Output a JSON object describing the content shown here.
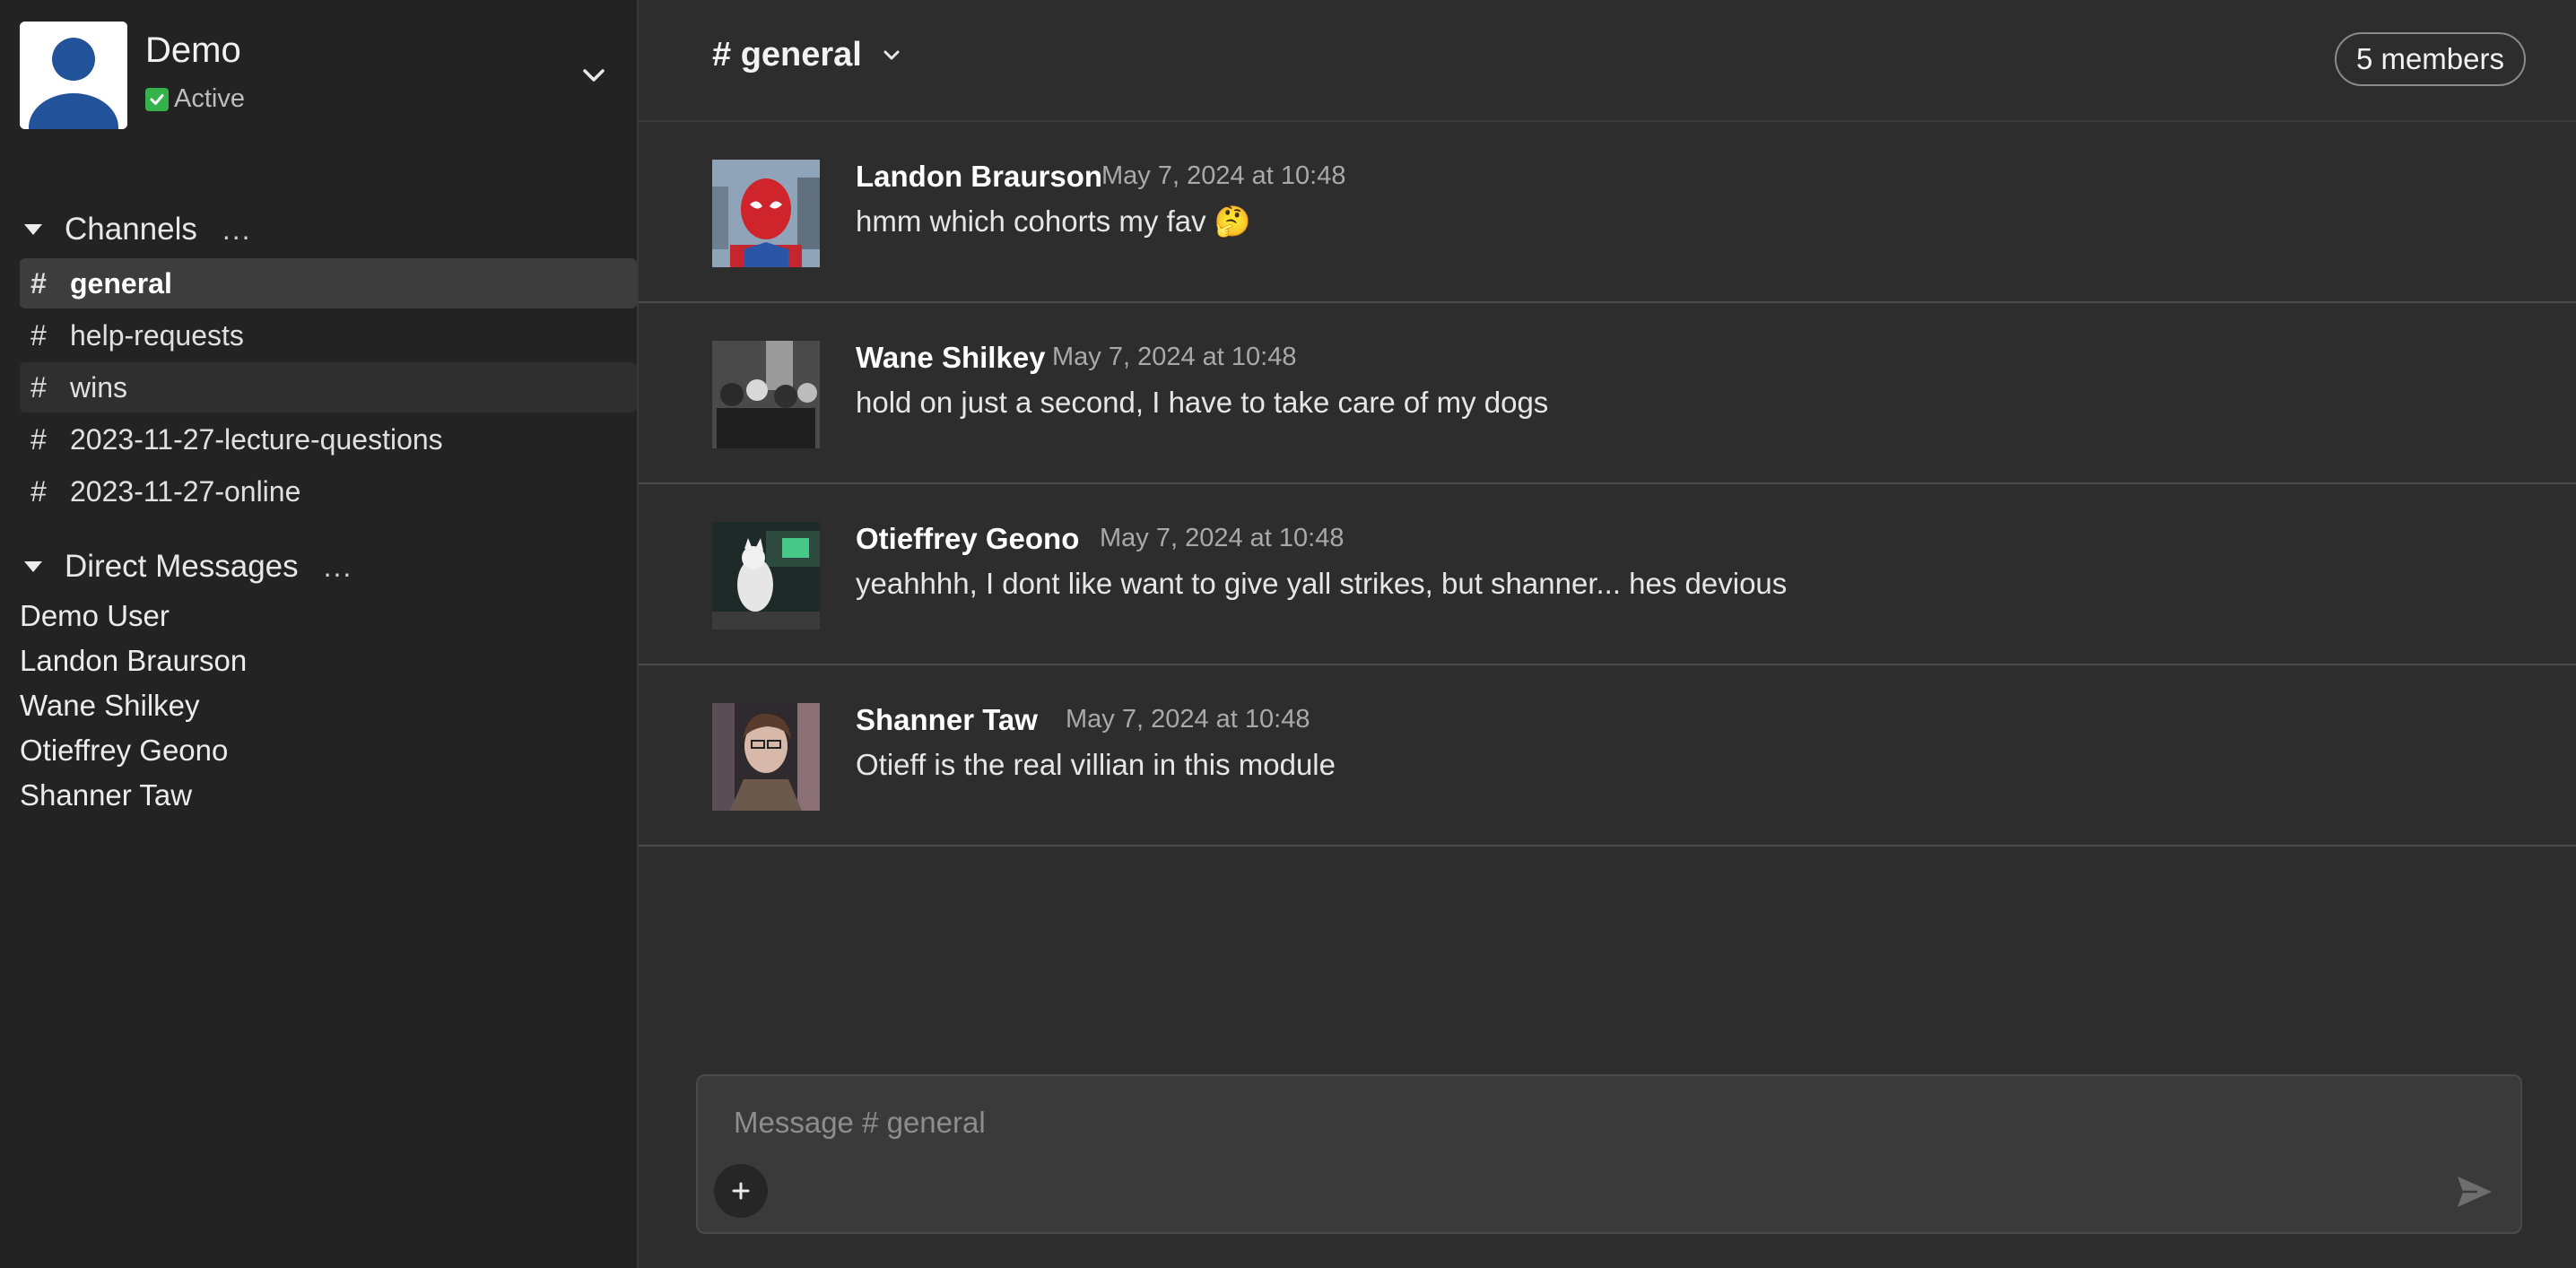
{
  "user": {
    "name": "Demo",
    "status": "Active",
    "status_icon": "check-mark-icon",
    "status_color": "#33b34a"
  },
  "channels_section": {
    "label": "Channels",
    "more": "...",
    "items": [
      {
        "hash": "#",
        "label": "general",
        "state": "active"
      },
      {
        "hash": "#",
        "label": "help-requests",
        "state": "normal"
      },
      {
        "hash": "#",
        "label": "wins",
        "state": "hover"
      },
      {
        "hash": "#",
        "label": "2023-11-27-lecture-questions",
        "state": "normal"
      },
      {
        "hash": "#",
        "label": "2023-11-27-online",
        "state": "normal"
      }
    ]
  },
  "dm_section": {
    "label": "Direct Messages",
    "more": "...",
    "items": [
      "Demo User",
      "Landon Braurson",
      "Wane Shilkey",
      "Otieffrey Geono",
      "Shanner Taw"
    ]
  },
  "main": {
    "channel_title": "# general",
    "members_label": "5 members"
  },
  "messages": [
    {
      "author": "Landon Braurson",
      "time": "May 7, 2024 at 10:48",
      "text": "hmm which cohorts my fav 🤔",
      "avatar": "spiderman-avatar"
    },
    {
      "author": "Wane Shilkey",
      "time": "May 7, 2024 at 10:48",
      "text": "hold on just a second, I have to take care of my dogs",
      "avatar": "group-photo-avatar"
    },
    {
      "author": "Otieffrey Geono",
      "time": "May 7, 2024 at 10:48",
      "text": "yeahhhh, I dont like want to give yall strikes, but shanner... hes devious",
      "avatar": "dog-avatar"
    },
    {
      "author": "Shanner Taw",
      "time": "May 7, 2024 at 10:48",
      "text": "Otieff is the real villian in this module",
      "avatar": "portrait-avatar"
    }
  ],
  "composer": {
    "placeholder": "Message # general",
    "value": ""
  },
  "colors": {
    "sidebar_bg": "#232323",
    "main_bg": "#2d2d2d",
    "active_channel_bg": "#3d3d3d",
    "avatar_blue": "#22539a"
  }
}
